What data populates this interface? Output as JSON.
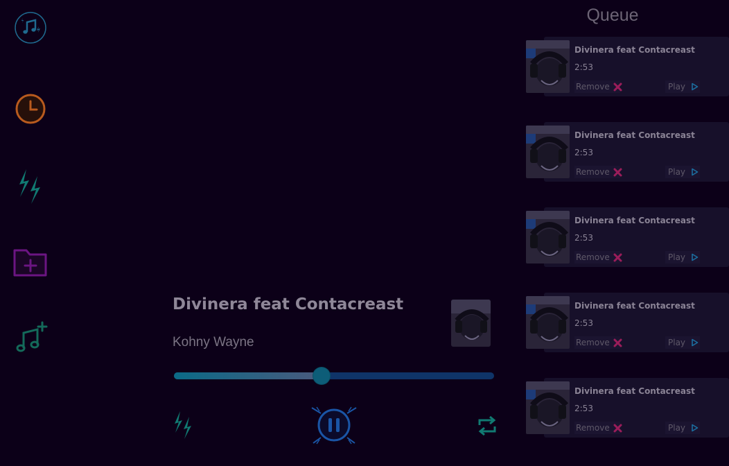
{
  "sidebar": {
    "items": [
      {
        "name": "music-library",
        "icon": "music-notes-icon",
        "color": "#1f6a8f"
      },
      {
        "name": "history",
        "icon": "clock-icon",
        "color": "#b85a1e"
      },
      {
        "name": "shuffle-mix",
        "icon": "lightning-icon",
        "color": "#117a72"
      },
      {
        "name": "add-folder",
        "icon": "folder-plus-icon",
        "color": "#6b1582"
      },
      {
        "name": "add-song",
        "icon": "music-plus-icon",
        "color": "#146a5a"
      }
    ]
  },
  "player": {
    "title": "Divinera feat Contacreast",
    "artist": "Kohny Wayne",
    "progress": 0.46,
    "state": "playing",
    "shuffle_icon": "lightning-icon",
    "play_pause_icon": "pause-icon",
    "repeat_icon": "repeat-icon"
  },
  "queue": {
    "heading": "Queue",
    "items": [
      {
        "title": "Divinera feat Contacreast",
        "duration": "2:53",
        "remove_label": "Remove",
        "play_label": "Play"
      },
      {
        "title": "Divinera feat Contacreast",
        "duration": "2:53",
        "remove_label": "Remove",
        "play_label": "Play"
      },
      {
        "title": "Divinera feat Contacreast",
        "duration": "2:53",
        "remove_label": "Remove",
        "play_label": "Play"
      },
      {
        "title": "Divinera feat Contacreast",
        "duration": "2:53",
        "remove_label": "Remove",
        "play_label": "Play"
      },
      {
        "title": "Divinera feat Contacreast",
        "duration": "2:53",
        "remove_label": "Remove",
        "play_label": "Play"
      }
    ]
  },
  "colors": {
    "background": "#0c0018",
    "accent_blue": "#1a55a6",
    "accent_teal": "#117a72",
    "remove_pink": "#9a1d5a",
    "play_blue": "#1c6fa0"
  }
}
